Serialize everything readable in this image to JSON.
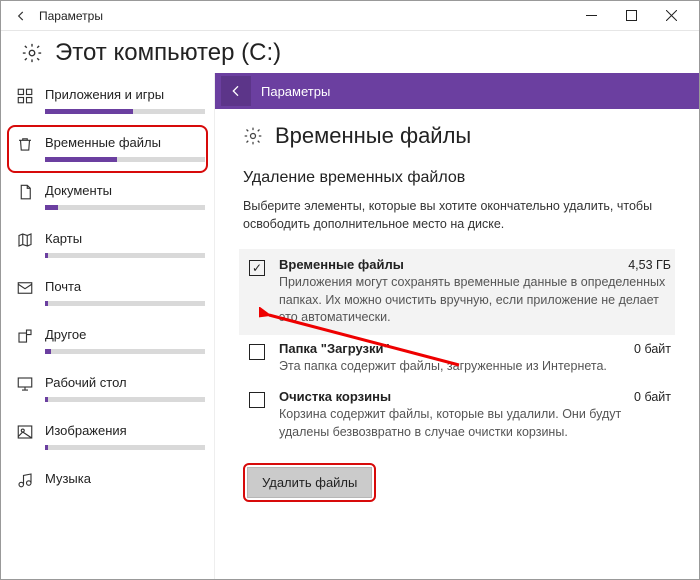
{
  "window": {
    "title": "Параметры"
  },
  "page": {
    "heading": "Этот компьютер (C:)"
  },
  "sidebar": {
    "items": [
      {
        "label": "Приложения и игры",
        "fill": 55
      },
      {
        "label": "Временные файлы",
        "fill": 45
      },
      {
        "label": "Документы",
        "fill": 8
      },
      {
        "label": "Карты",
        "fill": 2
      },
      {
        "label": "Почта",
        "fill": 2
      },
      {
        "label": "Другое",
        "fill": 4
      },
      {
        "label": "Рабочий стол",
        "fill": 2
      },
      {
        "label": "Изображения",
        "fill": 2
      },
      {
        "label": "Музыка",
        "fill": 1
      }
    ]
  },
  "subheader": {
    "title": "Параметры"
  },
  "content": {
    "title": "Временные файлы",
    "section_heading": "Удаление временных файлов",
    "intro": "Выберите элементы, которые вы хотите окончательно удалить, чтобы освободить дополнительное место на диске.",
    "options": [
      {
        "name": "Временные файлы",
        "size": "4,53 ГБ",
        "desc": "Приложения могут сохранять временные данные в определенных папках. Их можно очистить вручную, если приложение не делает это автоматически.",
        "checked": true
      },
      {
        "name": "Папка \"Загрузки\"",
        "size": "0 байт",
        "desc": "Эта папка содержит файлы, загруженные из Интернета.",
        "checked": false
      },
      {
        "name": "Очистка корзины",
        "size": "0 байт",
        "desc": "Корзина содержит файлы, которые вы удалили. Они будут удалены безвозвратно в случае очистки корзины.",
        "checked": false
      }
    ],
    "delete_button": "Удалить файлы"
  }
}
